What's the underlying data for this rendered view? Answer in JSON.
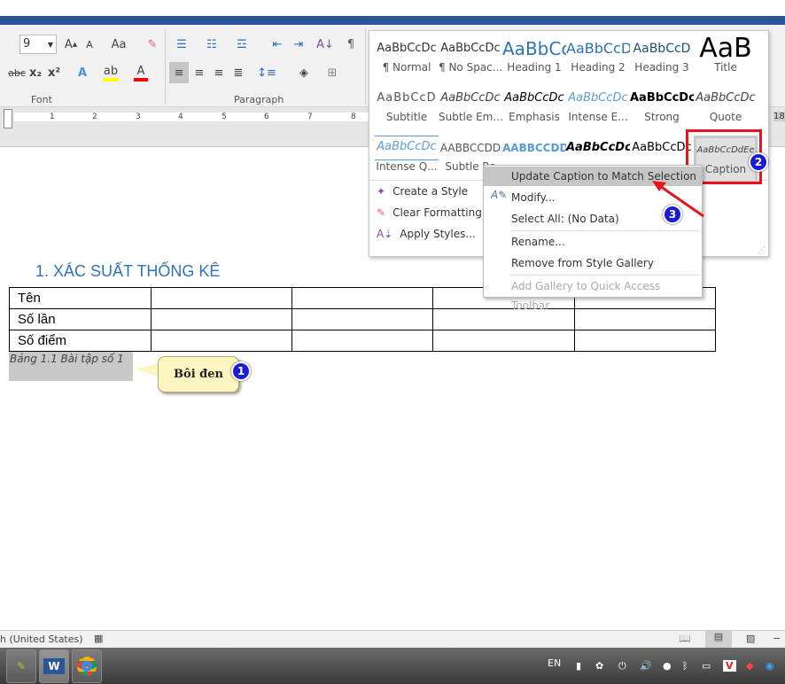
{
  "ribbon": {
    "font_size": "9",
    "change_case": "Aa",
    "font_group": "Font",
    "paragraph_group": "Paragraph"
  },
  "ruler": {
    "ticks": [
      "1",
      "2",
      "3",
      "4",
      "5",
      "6",
      "7",
      "8"
    ],
    "right_marker": "18"
  },
  "gallery": {
    "styles": [
      {
        "preview": "AaBbCcDc",
        "name": "¶ Normal"
      },
      {
        "preview": "AaBbCcDc",
        "name": "¶ No Spac..."
      },
      {
        "preview": "AaBbCc",
        "name": "Heading 1"
      },
      {
        "preview": "AaBbCcD",
        "name": "Heading 2"
      },
      {
        "preview": "AaBbCcD",
        "name": "Heading 3"
      },
      {
        "preview": "AaB",
        "name": "Title"
      },
      {
        "preview": "AaBbCcD",
        "name": "Subtitle"
      },
      {
        "preview": "AaBbCcDc",
        "name": "Subtle Em..."
      },
      {
        "preview": "AaBbCcDc",
        "name": "Emphasis"
      },
      {
        "preview": "AaBbCcDc",
        "name": "Intense E..."
      },
      {
        "preview": "AaBbCcDc",
        "name": "Strong"
      },
      {
        "preview": "AaBbCcDc",
        "name": "Quote"
      },
      {
        "preview": "AaBbCcDc",
        "name": "Intense Q..."
      },
      {
        "preview": "AABBCCDD",
        "name": "Subtle Re"
      },
      {
        "preview": "AABBCCDD",
        "name": ""
      },
      {
        "preview": "AaBbCcDc",
        "name": ""
      },
      {
        "preview": "AaBbCcDc",
        "name": ""
      },
      {
        "preview": "AaBbCcDdEe",
        "name": "Caption"
      }
    ],
    "commands": [
      "Create a Style",
      "Clear Formatting",
      "Apply Styles..."
    ]
  },
  "context_menu": {
    "items": [
      "Update Caption to Match Selection",
      "Modify...",
      "Select All: (No Data)",
      "Rename...",
      "Remove from Style Gallery",
      "Add Gallery to Quick Access Toolbar"
    ]
  },
  "document": {
    "heading": "1.  XÁC SUẤT THỐNG KÊ",
    "table_rows": [
      [
        "Tên",
        "",
        "",
        "",
        ""
      ],
      [
        "Số lần",
        "",
        "",
        "",
        ""
      ],
      [
        "Số điểm",
        "",
        "",
        "",
        ""
      ]
    ],
    "caption": "Bảng 1.1 Bài tập số 1"
  },
  "annotations": {
    "callout": "Bôi đen",
    "badge1": "1",
    "badge2": "2",
    "badge3": "3",
    "accent": "#e8141c"
  },
  "status": {
    "language": "h (United States)"
  },
  "taskbar": {
    "lang": "EN",
    "apps": [
      "Notepad++",
      "Word",
      "Chrome"
    ]
  }
}
